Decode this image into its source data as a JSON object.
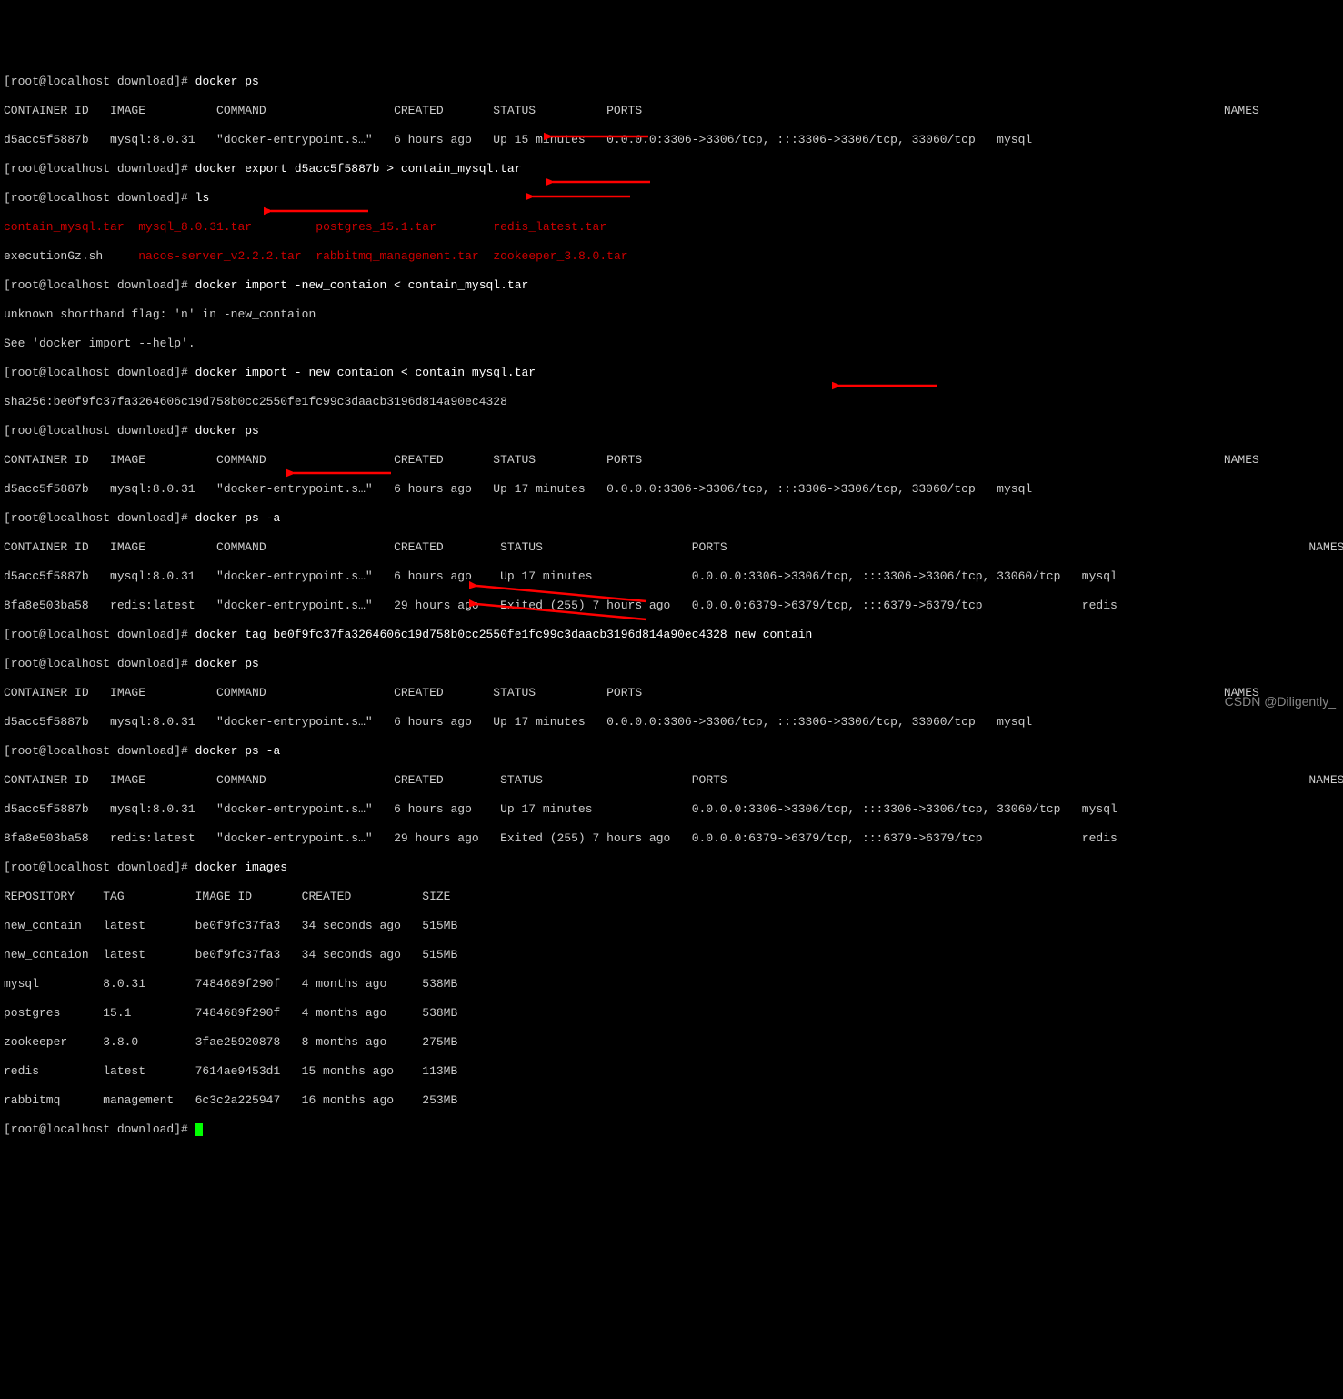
{
  "prompt": "[root@localhost download]# ",
  "blank4": "    ",
  "cmd": {
    "dockerPs": "docker ps",
    "dockerExport": "docker export d5acc5f5887b > contain_mysql.tar",
    "ls": "ls",
    "import1": "docker import -new_contaion < contain_mysql.tar",
    "import2": "docker import - new_contaion < contain_mysql.tar",
    "psA": "docker ps -a",
    "tag": "docker tag be0f9fc37fa3264606c19d758b0cc2550fe1fc99c3daacb3196d814a90ec4328 new_contain",
    "images": "docker images"
  },
  "header": {
    "ps": "CONTAINER ID   IMAGE          COMMAND                  CREATED       STATUS          PORTS                                                                                  NAMES",
    "psa": "CONTAINER ID   IMAGE          COMMAND                  CREATED        STATUS                     PORTS                                                                                  NAMES",
    "img": "REPOSITORY    TAG          IMAGE ID       CREATED          SIZE"
  },
  "row": {
    "mysql15": "d5acc5f5887b   mysql:8.0.31   \"docker-entrypoint.s…\"   6 hours ago   Up 15 minutes   0.0.0.0:3306->3306/tcp, :::3306->3306/tcp, 33060/tcp   mysql",
    "mysql17": "d5acc5f5887b   mysql:8.0.31   \"docker-entrypoint.s…\"   6 hours ago   Up 17 minutes   0.0.0.0:3306->3306/tcp, :::3306->3306/tcp, 33060/tcp   mysql",
    "mysql17a": "d5acc5f5887b   mysql:8.0.31   \"docker-entrypoint.s…\"   6 hours ago    Up 17 minutes              0.0.0.0:3306->3306/tcp, :::3306->3306/tcp, 33060/tcp   mysql",
    "redis": "8fa8e503ba58   redis:latest   \"docker-entrypoint.s…\"   29 hours ago   Exited (255) 7 hours ago   0.0.0.0:6379->6379/tcp, :::6379->6379/tcp              redis"
  },
  "ls": {
    "r1c1": "contain_mysql.tar",
    "r1c2": "mysql_8.0.31.tar",
    "r1c3": "postgres_15.1.tar",
    "r1c4": "redis_latest.tar",
    "r2c1": "executionGz.sh",
    "r2c2": "nacos-server_v2.2.2.tar",
    "r2c3": "rabbitmq_management.tar",
    "r2c4": "zookeeper_3.8.0.tar"
  },
  "msg": {
    "unknownFlag": "unknown shorthand flag: 'n' in -new_contaion",
    "seeHelp": "See 'docker import --help'.",
    "sha": "sha256:be0f9fc37fa3264606c19d758b0cc2550fe1fc99c3daacb3196d814a90ec4328"
  },
  "img": {
    "r1": "new_contain   latest       be0f9fc37fa3   34 seconds ago   515MB",
    "r2": "new_contaion  latest       be0f9fc37fa3   34 seconds ago   515MB",
    "r3": "mysql         8.0.31       7484689f290f   4 months ago     538MB",
    "r4": "postgres      15.1         7484689f290f   4 months ago     538MB",
    "r5": "zookeeper     3.8.0        3fae25920878   8 months ago     275MB",
    "r6": "redis         latest       7614ae9453d1   15 months ago    113MB",
    "r7": "rabbitmq      management   6c3c2a225947   16 months ago    253MB"
  },
  "watermark": "CSDN @Diligently_"
}
